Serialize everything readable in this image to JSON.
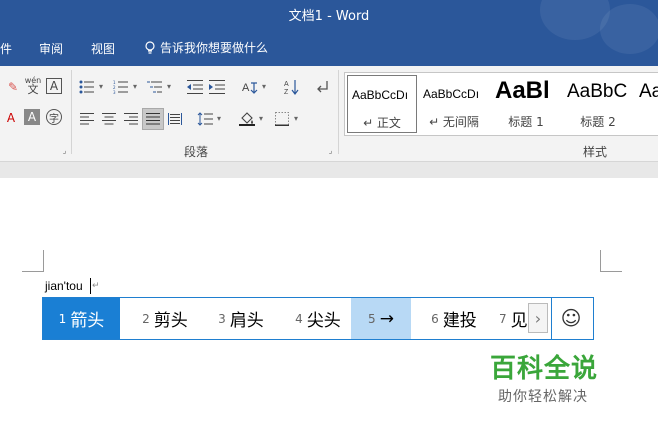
{
  "window": {
    "title": "文档1  -  Word"
  },
  "menu": {
    "items": [
      "件",
      "审阅",
      "视图"
    ],
    "tell_me": "告诉我你想要做什么"
  },
  "ribbon": {
    "font_icons": {
      "eraser": "✎",
      "pinyin_top": "wén",
      "pinyin_bottom": "文",
      "border_char": "A",
      "font_color": "A",
      "char_shading": "A",
      "enclosed_char": "字"
    },
    "paragraph_label": "段落",
    "styles_label": "样式",
    "styles": [
      {
        "sample": "AaBbCcDı",
        "name": "↵ 正文",
        "selected": true
      },
      {
        "sample": "AaBbCcDı",
        "name": "↵ 无间隔",
        "selected": false
      },
      {
        "sample": "AaBl",
        "name": "标题 1",
        "selected": false
      },
      {
        "sample": "AaBbC",
        "name": "标题 2",
        "selected": false
      },
      {
        "sample": "Aa",
        "name": "",
        "selected": false
      }
    ]
  },
  "document": {
    "typed_text": "jian'tou"
  },
  "ime": {
    "candidates": [
      {
        "num": "1",
        "word": "箭头",
        "state": "selected"
      },
      {
        "num": "2",
        "word": "剪头",
        "state": "normal"
      },
      {
        "num": "3",
        "word": "肩头",
        "state": "normal"
      },
      {
        "num": "4",
        "word": "尖头",
        "state": "normal"
      },
      {
        "num": "5",
        "word": "→",
        "state": "hover"
      },
      {
        "num": "6",
        "word": "建投",
        "state": "normal"
      },
      {
        "num": "7",
        "word": "见",
        "state": "normal"
      }
    ],
    "next_arrow": "›",
    "emoji": "☺"
  },
  "watermark": {
    "title": "百科全说",
    "subtitle": "助你轻松解决"
  },
  "colors": {
    "title_bar": "#2b579a",
    "ime_selected": "#1a7fd4",
    "ime_hover": "#b8d9f5",
    "watermark_green": "#3aa63a"
  }
}
